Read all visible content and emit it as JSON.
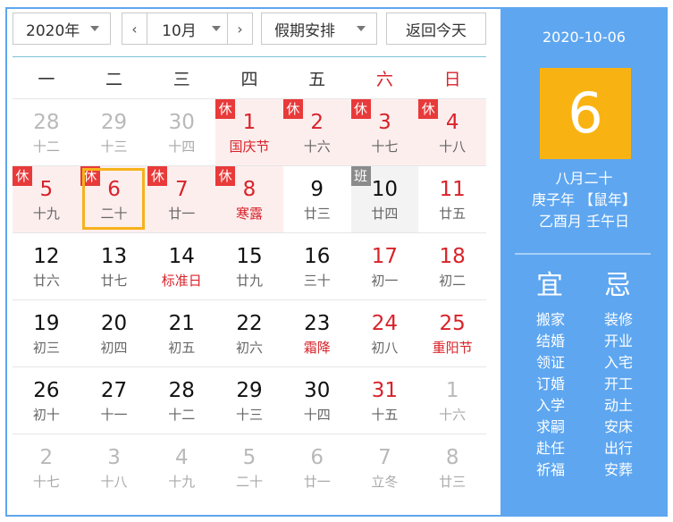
{
  "toolbar": {
    "year": "2020年",
    "month": "10月",
    "prev": "‹",
    "next": "›",
    "holiday": "假期安排",
    "today": "返回今天"
  },
  "weekdays": [
    "一",
    "二",
    "三",
    "四",
    "五",
    "六",
    "日"
  ],
  "days": [
    {
      "d": "28",
      "l": "十二",
      "other": true
    },
    {
      "d": "29",
      "l": "十三",
      "other": true
    },
    {
      "d": "30",
      "l": "十四",
      "other": true
    },
    {
      "d": "1",
      "l": "国庆节",
      "tag": "休",
      "hol": true
    },
    {
      "d": "2",
      "l": "十六",
      "tag": "休"
    },
    {
      "d": "3",
      "l": "十七",
      "tag": "休",
      "wk": true
    },
    {
      "d": "4",
      "l": "十八",
      "tag": "休",
      "wk": true
    },
    {
      "d": "5",
      "l": "十九",
      "tag": "休"
    },
    {
      "d": "6",
      "l": "二十",
      "tag": "休",
      "selected": true
    },
    {
      "d": "7",
      "l": "廿一",
      "tag": "休"
    },
    {
      "d": "8",
      "l": "寒露",
      "tag": "休",
      "hol": true
    },
    {
      "d": "9",
      "l": "廿三"
    },
    {
      "d": "10",
      "l": "廿四",
      "tag": "班",
      "tagType": "work"
    },
    {
      "d": "11",
      "l": "廿五",
      "wk": true
    },
    {
      "d": "12",
      "l": "廿六"
    },
    {
      "d": "13",
      "l": "廿七"
    },
    {
      "d": "14",
      "l": "标准日",
      "hol": true
    },
    {
      "d": "15",
      "l": "廿九"
    },
    {
      "d": "16",
      "l": "三十"
    },
    {
      "d": "17",
      "l": "初一",
      "wk": true
    },
    {
      "d": "18",
      "l": "初二",
      "wk": true
    },
    {
      "d": "19",
      "l": "初三"
    },
    {
      "d": "20",
      "l": "初四"
    },
    {
      "d": "21",
      "l": "初五"
    },
    {
      "d": "22",
      "l": "初六"
    },
    {
      "d": "23",
      "l": "霜降",
      "hol": true
    },
    {
      "d": "24",
      "l": "初八",
      "wk": true
    },
    {
      "d": "25",
      "l": "重阳节",
      "wk": true,
      "hol": true
    },
    {
      "d": "26",
      "l": "初十"
    },
    {
      "d": "27",
      "l": "十一"
    },
    {
      "d": "28",
      "l": "十二"
    },
    {
      "d": "29",
      "l": "十三"
    },
    {
      "d": "30",
      "l": "十四"
    },
    {
      "d": "31",
      "l": "十五",
      "wk": true
    },
    {
      "d": "1",
      "l": "十六",
      "other": true
    },
    {
      "d": "2",
      "l": "十七",
      "other": true
    },
    {
      "d": "3",
      "l": "十八",
      "other": true
    },
    {
      "d": "4",
      "l": "十九",
      "other": true
    },
    {
      "d": "5",
      "l": "二十",
      "other": true
    },
    {
      "d": "6",
      "l": "廿一",
      "other": true
    },
    {
      "d": "7",
      "l": "立冬",
      "other": true
    },
    {
      "d": "8",
      "l": "廿三",
      "other": true
    }
  ],
  "panel": {
    "date": "2020-10-06",
    "day": "6",
    "lunar1": "八月二十",
    "lunar2": "庚子年 【鼠年】",
    "lunar3": "乙酉月 壬午日",
    "yi_title": "宜",
    "ji_title": "忌",
    "yi": [
      "搬家",
      "结婚",
      "领证",
      "订婚",
      "入学",
      "求嗣",
      "赴任",
      "祈福"
    ],
    "ji": [
      "装修",
      "开业",
      "入宅",
      "开工",
      "动土",
      "安床",
      "出行",
      "安葬"
    ]
  },
  "colors": {
    "accent": "#5ea6f0",
    "highlight": "#f8b312",
    "holiday_red": "#d8232a",
    "rest_bg": "#fdeeee",
    "rest_tag": "#e83a3a",
    "work_tag": "#8b8b8b"
  }
}
